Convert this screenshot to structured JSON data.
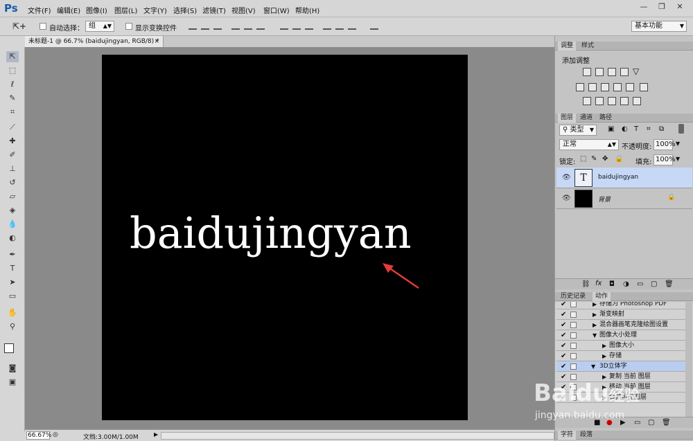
{
  "app": {
    "logo": "Ps"
  },
  "menu": [
    "文件(F)",
    "编辑(E)",
    "图像(I)",
    "图层(L)",
    "文字(Y)",
    "选择(S)",
    "滤镜(T)",
    "视图(V)",
    "窗口(W)",
    "帮助(H)"
  ],
  "window": {
    "minimize": "—",
    "restore": "❐",
    "close": "✕"
  },
  "options": {
    "auto_select_label": "自动选择：",
    "auto_select_value": "组",
    "show_transform_label": "显示变换控件",
    "workspace": "基本功能"
  },
  "document": {
    "tab_title": "未标题-1 @ 66.7% (baidujingyan, RGB/8) *",
    "tab_close": "×",
    "canvas_text": "baidujingyan"
  },
  "status": {
    "zoom": "66.67%",
    "doc_info": "文档:3.00M/1.00M"
  },
  "panels": {
    "adjust_tabs": [
      "调整",
      "样式"
    ],
    "adjust_title": "添加调整",
    "layer_tabs": [
      "图层",
      "通道",
      "路径"
    ],
    "filter_type": "类型",
    "blend_mode": "正常",
    "opacity_label": "不透明度:",
    "opacity_value": "100%",
    "lock_label": "锁定:",
    "fill_label": "填充:",
    "fill_value": "100%",
    "layers": [
      {
        "name": "baidujingyan",
        "thumb": "T"
      },
      {
        "name": "背景"
      }
    ],
    "actions_tabs": [
      "历史记录",
      "动作"
    ],
    "actions": [
      "存储为 Photoshop PDF",
      "渐变映射",
      "混合器画笔克隆绘图设置",
      "图像大小处理",
      "图像大小",
      "存储",
      "3D立体字",
      "复制 当前 图层",
      "移动 当前 图层",
      "合并可见图层"
    ],
    "bottom_tabs": [
      "字符",
      "段落"
    ]
  },
  "watermark": {
    "line1": "Baidu",
    "line2": "经验",
    "line3": "jingyan.baidu.com"
  }
}
